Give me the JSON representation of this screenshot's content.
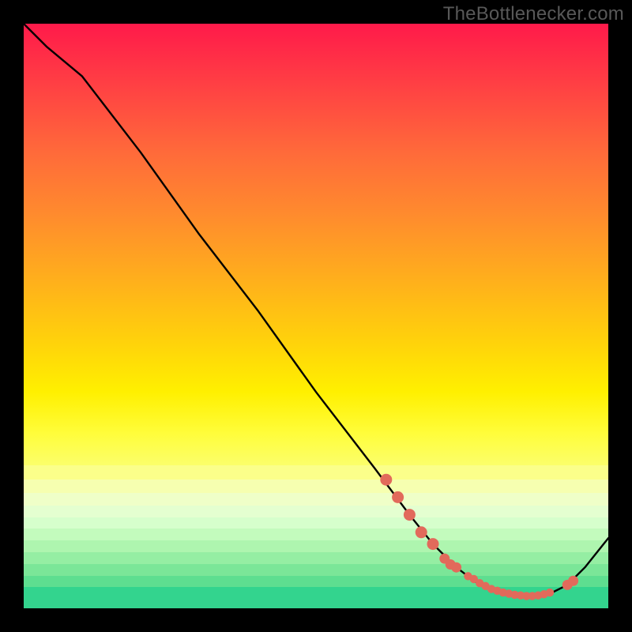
{
  "attribution": "TheBottlenecker.com",
  "colors": {
    "bg": "#000000",
    "curve": "#000000",
    "dot": "#e26a5b",
    "gradient_top": "#ff1a4a",
    "gradient_mid": "#fff000",
    "gradient_bottom": "#2fd58f"
  },
  "chart_data": {
    "type": "line",
    "title": "",
    "xlabel": "",
    "ylabel": "",
    "xlim": [
      0,
      100
    ],
    "ylim": [
      0,
      100
    ],
    "grid": false,
    "comment": "Axes are unlabeled percent scales; y=0 is bottom (green/optimal), y=100 is top (red/max bottleneck). Values are read from the plot as percentages of axis range.",
    "x": [
      0,
      4,
      10,
      20,
      30,
      40,
      50,
      60,
      66,
      70,
      74,
      78,
      82,
      86,
      90,
      93,
      96,
      100
    ],
    "y_curve": [
      100,
      96,
      91,
      78,
      64,
      51,
      37,
      24,
      16,
      11,
      7,
      4,
      2.5,
      2,
      2.5,
      4,
      7,
      12
    ],
    "highlighted_points": {
      "comment": "Pink/red marker dots drawn on the curve near its minimum.",
      "x": [
        62,
        64,
        66,
        68,
        70,
        72,
        73,
        74,
        76,
        77,
        78,
        79,
        80,
        81,
        82,
        83,
        84,
        85,
        86,
        87,
        88,
        89,
        90,
        93,
        94
      ],
      "y": [
        22,
        19,
        16,
        13,
        11,
        8.5,
        7.5,
        7,
        5.5,
        5,
        4.3,
        3.8,
        3.3,
        3,
        2.7,
        2.5,
        2.3,
        2.2,
        2.1,
        2.1,
        2.2,
        2.4,
        2.7,
        4,
        4.7
      ]
    }
  }
}
